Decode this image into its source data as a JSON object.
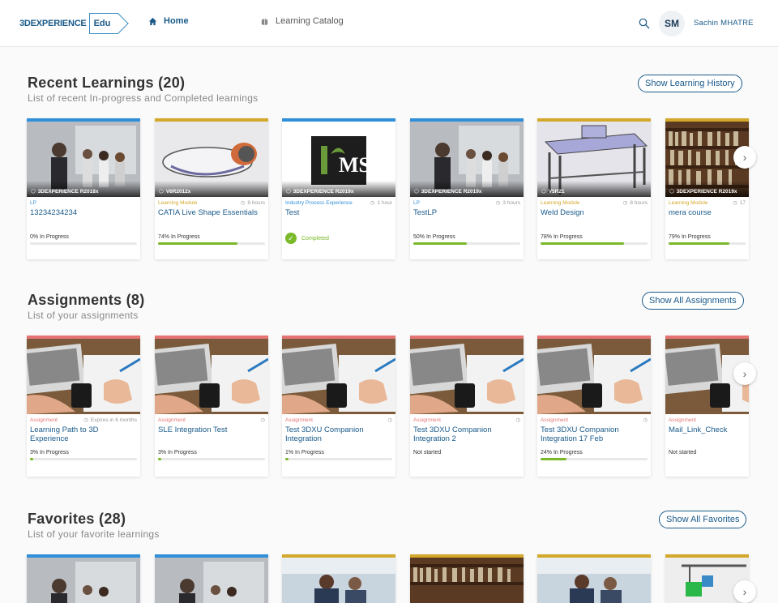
{
  "header": {
    "logo_main": "3DEXPERIENCE",
    "logo_edu": "Edu",
    "nav_home": "Home",
    "nav_catalog": "Learning Catalog",
    "avatar_initials": "SM",
    "user_name": "Sachin MHATRE"
  },
  "recent": {
    "title": "Recent Learnings (20)",
    "subtitle": "List of recent In-progress and Completed learnings",
    "button": "Show Learning History",
    "cards": [
      {
        "caption": "3DEXPERIENCE R2018x",
        "type": "LP",
        "duration": "",
        "title": "13234234234",
        "status": "0% In Progress",
        "progress": 0
      },
      {
        "caption": "V6R2012x",
        "type": "Learning Module",
        "duration": "8 hours",
        "title": "CATIA Live Shape Essentials",
        "status": "74% In Progress",
        "progress": 74
      },
      {
        "caption": "3DEXPERIENCE R2019x",
        "type": "Industry Process Experience",
        "duration": "1 hour",
        "title": "Test",
        "status": "Completed",
        "progress": 100
      },
      {
        "caption": "3DEXPERIENCE R2019x",
        "type": "LP",
        "duration": "3 hours",
        "title": "TestLP",
        "status": "50% In Progress",
        "progress": 50
      },
      {
        "caption": "V5R21",
        "type": "Learning Module",
        "duration": "8 hours",
        "title": "Weld Design",
        "status": "78% In Progress",
        "progress": 78
      },
      {
        "caption": "3DEXPERIENCE R2019x",
        "type": "Learning Module",
        "duration": "17",
        "title": "mera course",
        "status": "79% In Progress",
        "progress": 79
      }
    ]
  },
  "assignments": {
    "title": "Assignments (8)",
    "subtitle": "List of your assignments",
    "button": "Show All Assignments",
    "cards": [
      {
        "type": "Assignment",
        "duration": "Expires in 6 months",
        "title": "Learning Path to 3D Experience",
        "status": "3% In Progress",
        "progress": 3
      },
      {
        "type": "Assignment",
        "duration": "",
        "title": "SLE Integration Test",
        "status": "3% In Progress",
        "progress": 3
      },
      {
        "type": "Assignment",
        "duration": "",
        "title": "Test 3DXU Companion Integration",
        "status": "1% In Progress",
        "progress": 1
      },
      {
        "type": "Assignment",
        "duration": "",
        "title": "Test 3DXU Companion Integration 2",
        "status": "Not started",
        "progress": null
      },
      {
        "type": "Assignment",
        "duration": "",
        "title": "Test 3DXU Companion Integration 17 Feb",
        "status": "24% In Progress",
        "progress": 24
      },
      {
        "type": "Assignment",
        "duration": "",
        "title": "Mail_Link_Check",
        "status": "Not started",
        "progress": null
      }
    ]
  },
  "favorites": {
    "title": "Favorites (28)",
    "subtitle": "List of your favorite learnings",
    "button": "Show All Favorites"
  },
  "colors": {
    "brand": "#1a5a8a",
    "lp_top": "#2f8fd8",
    "module_top": "#d4a82a",
    "ipe_top": "#2f8fd8",
    "assignment_top": "#e57373",
    "progress": "#7ab929"
  },
  "icons": {
    "home": "home-icon",
    "catalog": "catalog-icon",
    "search": "search-icon",
    "next": "chevron-right-icon",
    "clock": "clock-icon",
    "check": "check-icon"
  }
}
